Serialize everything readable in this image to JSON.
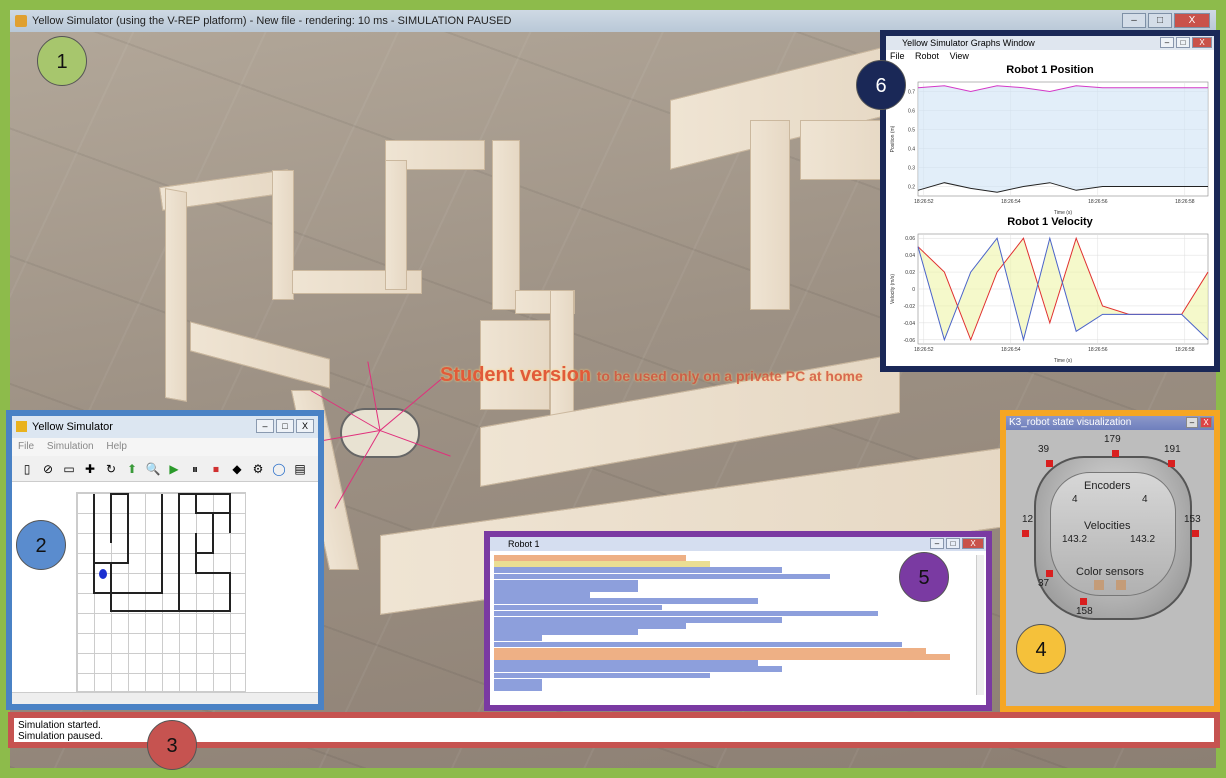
{
  "window": {
    "title": "Yellow Simulator (using the V-REP platform) - New file - rendering: 10 ms - SIMULATION PAUSED",
    "buttons": [
      "–",
      "□",
      "X"
    ]
  },
  "badges": [
    "1",
    "2",
    "3",
    "4",
    "5",
    "6"
  ],
  "badge_colors": [
    "#a7c66d",
    "#5a8cce",
    "#c65350",
    "#f5c13a",
    "#7a3aa2",
    "#1a2857"
  ],
  "watermark": {
    "main": "Student version",
    "rest": "to be used only on a private PC at home"
  },
  "yellow_sim": {
    "title": "Yellow Simulator",
    "menu": [
      "File",
      "Simulation",
      "Help"
    ],
    "tools": [
      "▯",
      "⊘",
      "▭",
      "✚",
      "↻",
      "⬆",
      "🔍",
      "▶",
      "⏸",
      "⏹",
      "◆",
      "⚙",
      "◯",
      "▤"
    ]
  },
  "log": {
    "lines": [
      "Simulation started.",
      "Simulation paused."
    ]
  },
  "robot_state": {
    "title": "K3_robot state visualization",
    "sensor_values": {
      "top": "179",
      "top_left": "39",
      "top_right": "191",
      "left": "12",
      "right": "153",
      "bottom_left": "37",
      "bottom": "158"
    },
    "encoders_label": "Encoders",
    "encoder_left": "4",
    "encoder_right": "4",
    "velocities_label": "Velocities",
    "velocity_left": "143.2",
    "velocity_right": "143.2",
    "color_label": "Color sensors"
  },
  "code_editor": {
    "title": "Robot 1"
  },
  "graphs": {
    "title": "Yellow Simulator Graphs Window",
    "menu": [
      "File",
      "Robot",
      "View"
    ]
  },
  "chart_data": [
    {
      "type": "line",
      "title": "Robot 1 Position",
      "xlabel": "Time (s)",
      "ylabel": "Position (m)",
      "x_ticks": [
        "18:26:52",
        "18:26:54",
        "18:26:56",
        "18:26:58"
      ],
      "y_ticks": [
        0.2,
        0.3,
        0.4,
        0.5,
        0.6,
        0.7
      ],
      "ylim": [
        0.15,
        0.75
      ],
      "series": [
        {
          "color": "#d438c7",
          "values": [
            0.72,
            0.73,
            0.7,
            0.73,
            0.72,
            0.7,
            0.73,
            0.72,
            0.72,
            0.72,
            0.72,
            0.72
          ]
        },
        {
          "color": "#222222",
          "values": [
            0.18,
            0.22,
            0.19,
            0.17,
            0.2,
            0.22,
            0.18,
            0.2,
            0.2,
            0.2,
            0.2,
            0.2
          ]
        }
      ]
    },
    {
      "type": "line",
      "title": "Robot 1 Velocity",
      "xlabel": "Time (s)",
      "ylabel": "Velocity (m/s)",
      "x_ticks": [
        "18:26:52",
        "18:26:54",
        "18:26:56",
        "18:26:58"
      ],
      "y_ticks": [
        0.06,
        0.04,
        0.02,
        0,
        -0.02,
        -0.04,
        -0.06
      ],
      "ylim": [
        -0.065,
        0.065
      ],
      "series": [
        {
          "color": "#e03030",
          "values": [
            0.05,
            0.02,
            -0.06,
            0.02,
            0.06,
            -0.04,
            0.06,
            -0.02,
            -0.03,
            -0.03,
            -0.03,
            0.02
          ]
        },
        {
          "color": "#4a63c9",
          "values": [
            0.05,
            -0.06,
            0.02,
            0.06,
            -0.06,
            0.06,
            -0.05,
            -0.03,
            -0.03,
            -0.03,
            -0.03,
            -0.06
          ]
        }
      ]
    }
  ]
}
